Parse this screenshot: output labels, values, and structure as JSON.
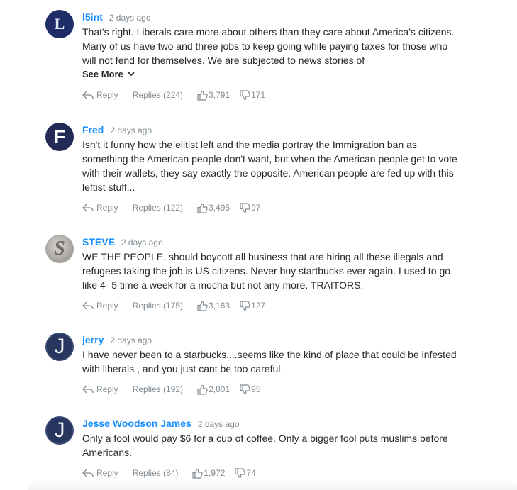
{
  "comments": [
    {
      "avatar_letter": "L",
      "author": "l5int",
      "time": "2 days ago",
      "text": "That's right. Liberals care more about others than they care about America's citizens. Many of us have two and three jobs to keep going while paying taxes for those who will not fend for themselves. We are subjected to news stories of",
      "see_more": "See More",
      "reply_label": "Reply",
      "replies": "Replies (224)",
      "likes": "3,791",
      "dislikes": "171"
    },
    {
      "avatar_letter": "F",
      "author": "Fred",
      "time": "2 days ago",
      "text": "Isn't it funny how the elitist left and the media portray the Immigration ban as something the American people don't want, but when the American people get to vote with their wallets, they say exactly the opposite. American people are fed up with this leftist stuff...",
      "reply_label": "Reply",
      "replies": "Replies (122)",
      "likes": "3,495",
      "dislikes": "97"
    },
    {
      "avatar_letter": "S",
      "author": "STEVE",
      "time": "2 days ago",
      "text": "WE THE PEOPLE. should boycott all business that are hiring all these illegals and refugees taking the job is US citizens. Never buy startbucks ever again. I used to go like 4- 5 time a week for a mocha but not any more. TRAITORS.",
      "reply_label": "Reply",
      "replies": "Replies (175)",
      "likes": "3,163",
      "dislikes": "127"
    },
    {
      "avatar_letter": "J",
      "author": "jerry",
      "time": "2 days ago",
      "text": "I have never been to a starbucks....seems like the kind of place that could be infested with liberals , and you just cant be too careful.",
      "reply_label": "Reply",
      "replies": "Replies (192)",
      "likes": "2,801",
      "dislikes": "95"
    },
    {
      "avatar_letter": "J",
      "author": "Jesse Woodson James",
      "time": "2 days ago",
      "text": "Only a fool would pay $6 for a cup of coffee. Only a bigger fool puts muslims before Americans.",
      "reply_label": "Reply",
      "replies": "Replies (84)",
      "likes": "1,972",
      "dislikes": "74"
    }
  ],
  "icons": {
    "reply": "reply-arrow-icon",
    "like": "thumbs-up-icon",
    "dislike": "thumbs-down-icon",
    "expand": "chevron-down-icon"
  },
  "colors": {
    "author_link": "#188fff",
    "meta_gray": "#828c93",
    "body_text": "#26282a"
  }
}
